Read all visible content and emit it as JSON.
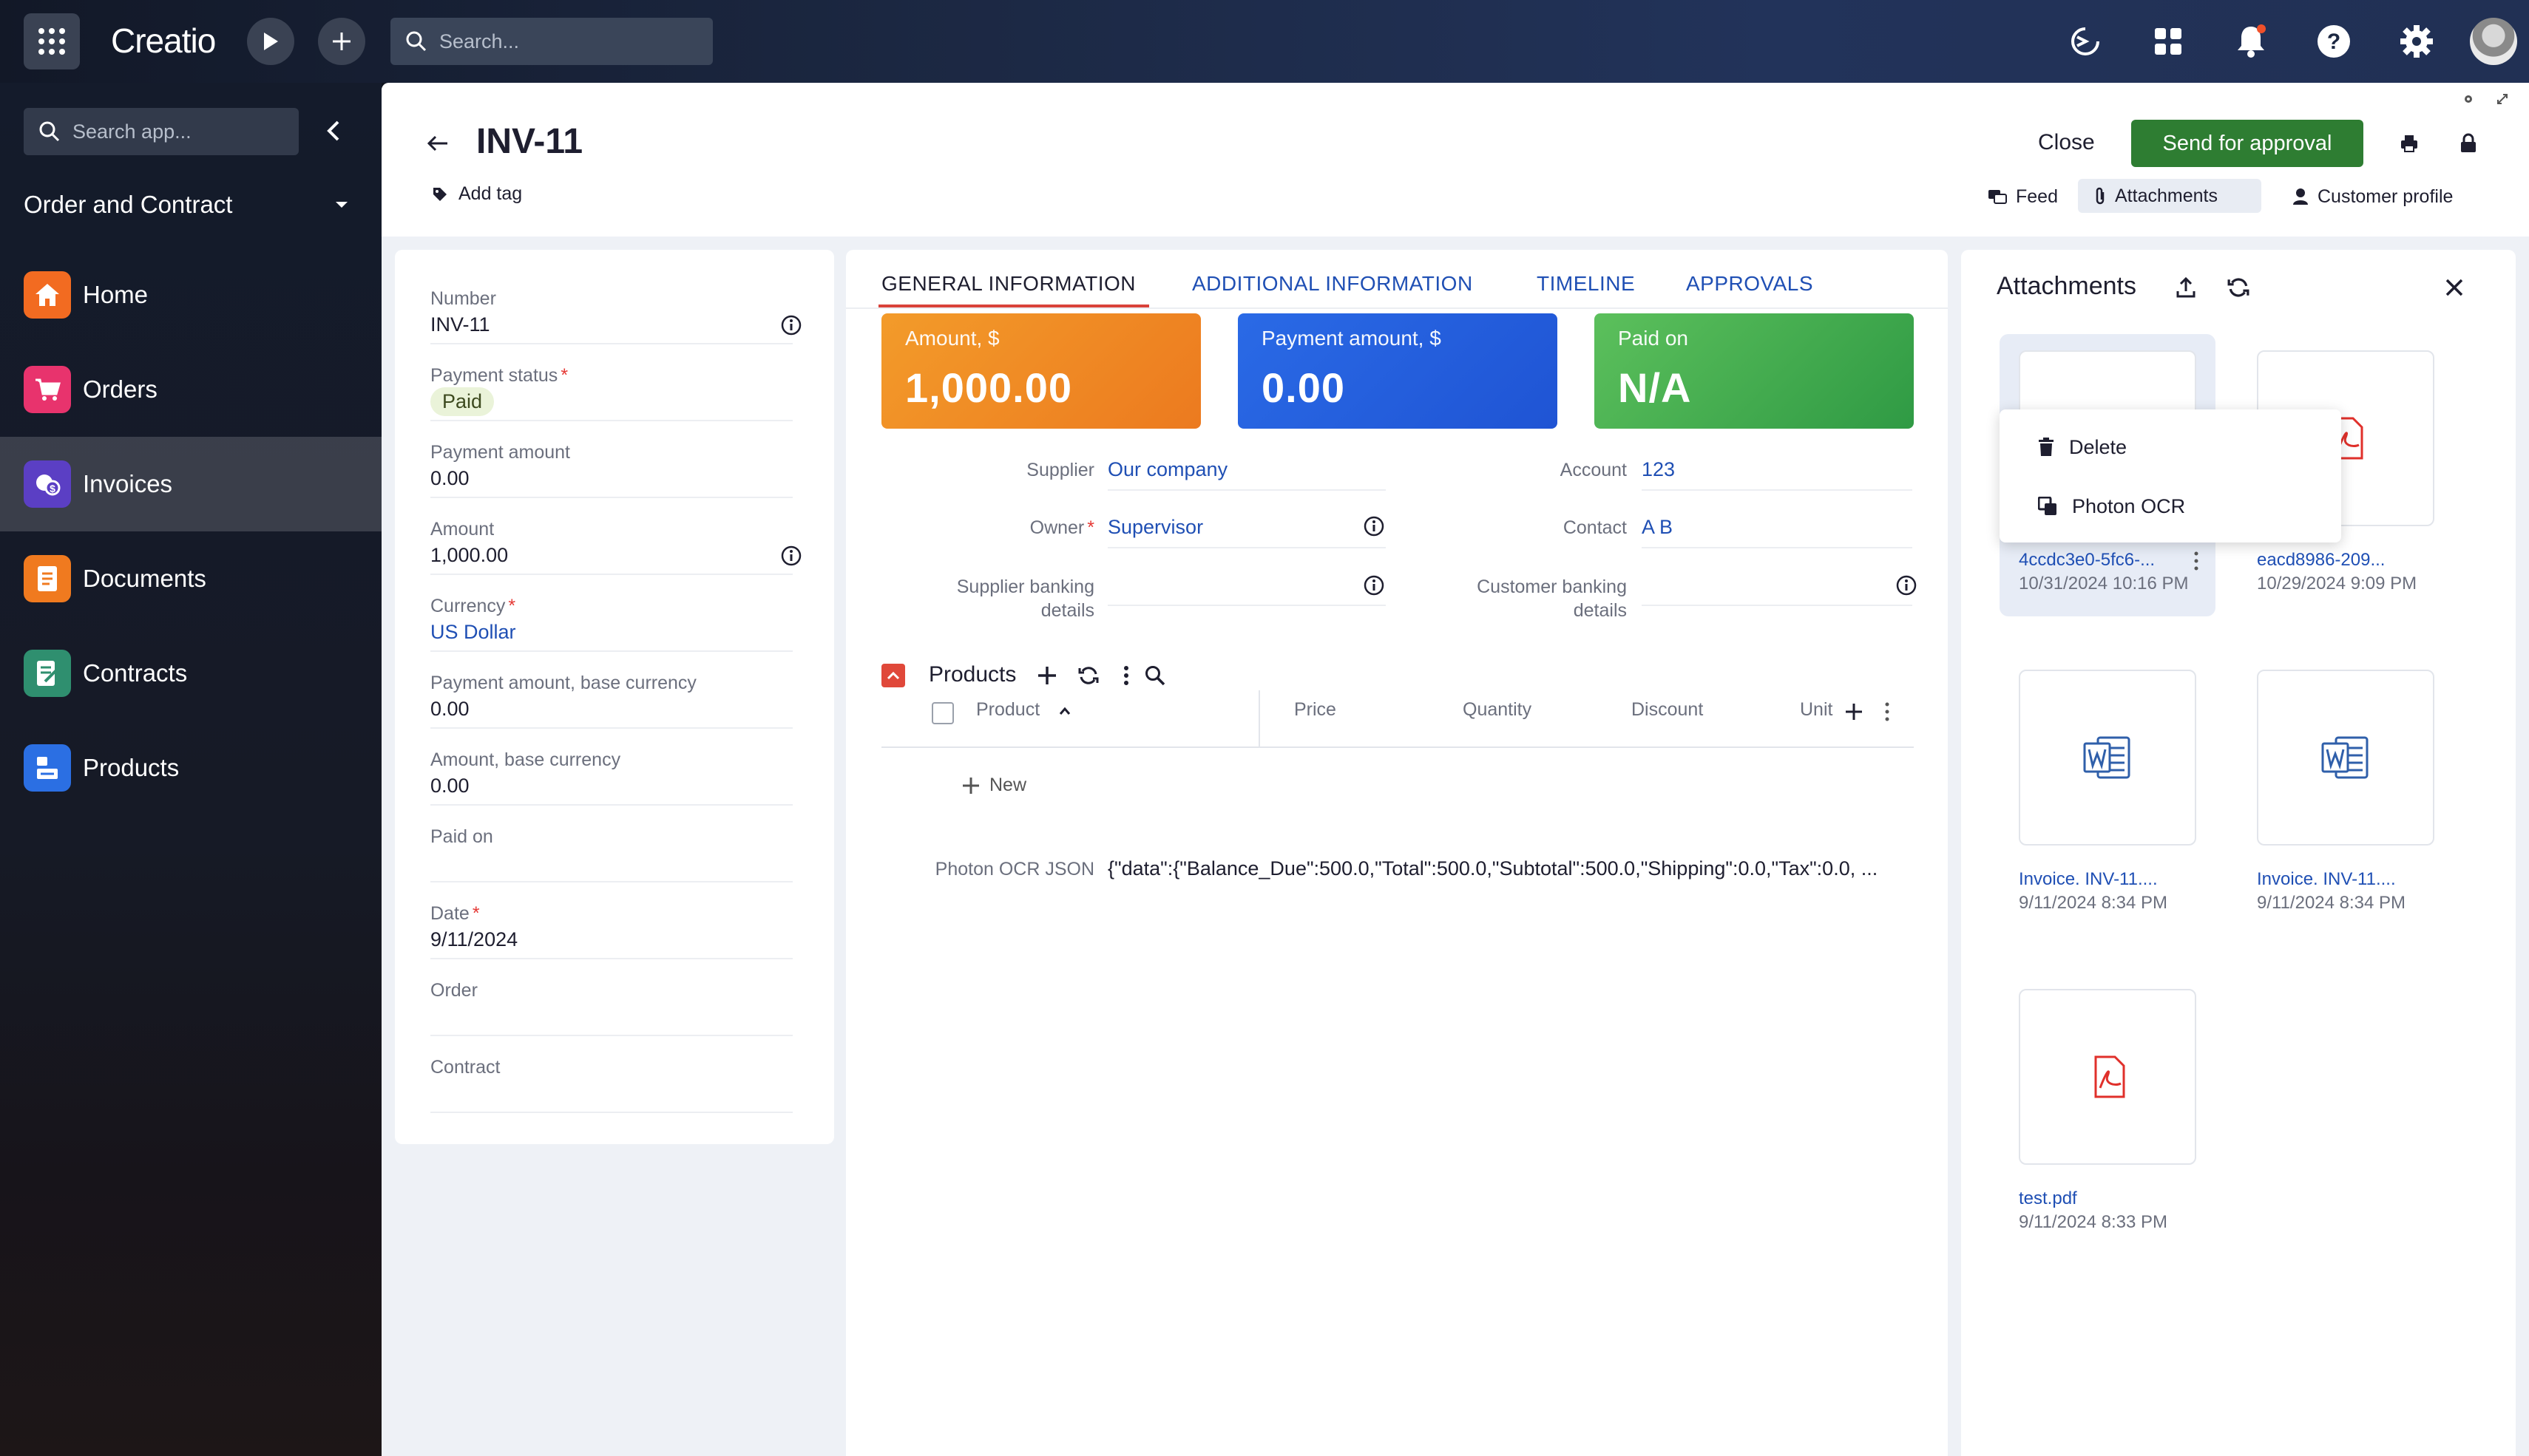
{
  "topbar": {
    "brand": "Creatio",
    "search_placeholder": "Search..."
  },
  "sidebar": {
    "search_placeholder": "Search app...",
    "workspace": "Order and Contract",
    "items": [
      {
        "label": "Home",
        "color": "#f26b21"
      },
      {
        "label": "Orders",
        "color": "#e8336d"
      },
      {
        "label": "Invoices",
        "color": "#5b3fc4"
      },
      {
        "label": "Documents",
        "color": "#f07a1f"
      },
      {
        "label": "Contracts",
        "color": "#2f8f6f"
      },
      {
        "label": "Products",
        "color": "#2b6fe3"
      }
    ],
    "active_index": 2
  },
  "header": {
    "title": "INV-11",
    "add_tag": "Add tag",
    "close": "Close",
    "send": "Send for approval",
    "feed": "Feed",
    "attachments": "Attachments",
    "customer_profile": "Customer profile"
  },
  "left_fields": [
    {
      "label": "Number",
      "value": "INV-11",
      "info": true
    },
    {
      "label": "Payment status",
      "required": true,
      "badge": "Paid"
    },
    {
      "label": "Payment amount",
      "value": "0.00"
    },
    {
      "label": "Amount",
      "value": "1,000.00",
      "info": true
    },
    {
      "label": "Currency",
      "required": true,
      "value": "US Dollar",
      "link": true
    },
    {
      "label": "Payment amount, base currency",
      "value": "0.00"
    },
    {
      "label": "Amount, base currency",
      "value": "0.00"
    },
    {
      "label": "Paid on",
      "value": ""
    },
    {
      "label": "Date",
      "required": true,
      "value": "9/11/2024"
    },
    {
      "label": "Order",
      "value": ""
    },
    {
      "label": "Contract",
      "value": ""
    }
  ],
  "tabs": [
    "GENERAL INFORMATION",
    "ADDITIONAL INFORMATION",
    "TIMELINE",
    "APPROVALS"
  ],
  "kpis": [
    {
      "label": "Amount, $",
      "value": "1,000.00",
      "color": "#f08a22"
    },
    {
      "label": "Payment amount, $",
      "value": "0.00",
      "color": "#2560de"
    },
    {
      "label": "Paid on",
      "value": "N/A",
      "color": "#3ea84a"
    }
  ],
  "details": {
    "supplier_label": "Supplier",
    "supplier": "Our company",
    "owner_label": "Owner",
    "owner": "Supervisor",
    "supplier_banking_label_1": "Supplier banking",
    "supplier_banking_label_2": "details",
    "account_label": "Account",
    "account": "123",
    "contact_label": "Contact",
    "contact": "A B",
    "customer_banking_label_1": "Customer banking",
    "customer_banking_label_2": "details"
  },
  "products": {
    "title": "Products",
    "columns": [
      "Product",
      "Price",
      "Quantity",
      "Discount",
      "Unit"
    ],
    "new_label": "New"
  },
  "ocr": {
    "label": "Photon OCR JSON",
    "value": "{\"data\":{\"Balance_Due\":500.0,\"Total\":500.0,\"Subtotal\":500.0,\"Shipping\":0.0,\"Tax\":0.0, ..."
  },
  "attachments_panel": {
    "title": "Attachments",
    "menu": [
      "Delete",
      "Photon OCR"
    ],
    "files": [
      {
        "name": "4ccdc3e0-5fc6-...",
        "date": "10/31/2024 10:16 PM",
        "icon": "blank-file-icon"
      },
      {
        "name": "eacd8986-209...",
        "date": "10/29/2024 9:09 PM",
        "icon": "pdf-icon"
      },
      {
        "name": "Invoice. INV-11....",
        "date": "9/11/2024 8:34 PM",
        "icon": "word-icon"
      },
      {
        "name": "Invoice. INV-11....",
        "date": "9/11/2024 8:34 PM",
        "icon": "word-icon"
      },
      {
        "name": "test.pdf",
        "date": "9/11/2024 8:33 PM",
        "icon": "pdf-icon"
      }
    ]
  }
}
